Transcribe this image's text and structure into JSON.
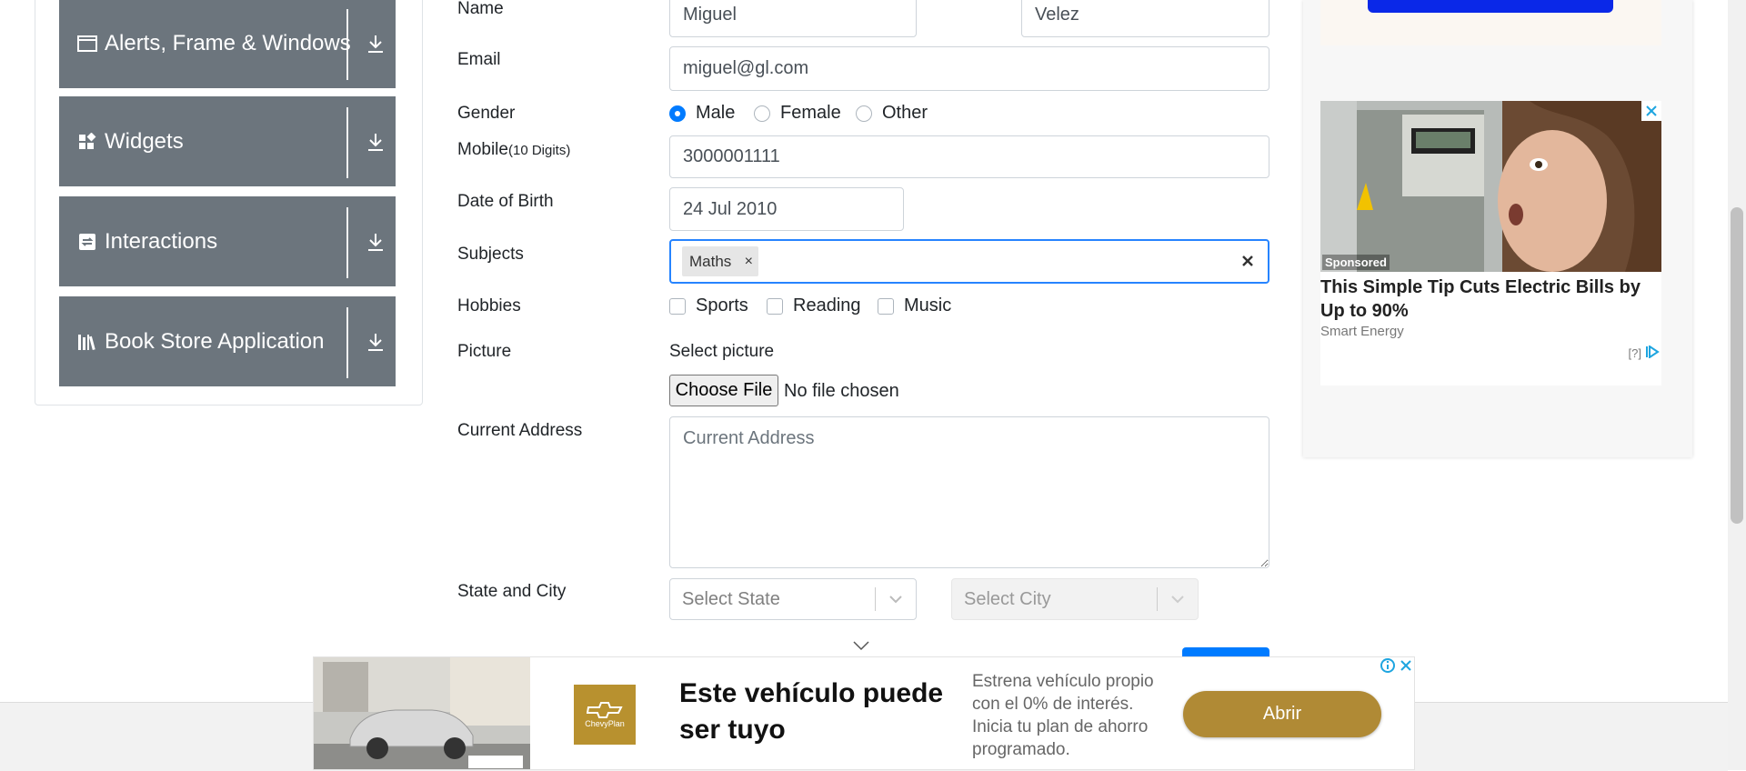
{
  "sidebar": {
    "groups": [
      {
        "label": "Alerts, Frame & Windows",
        "icon": "window-icon"
      },
      {
        "label": "Widgets",
        "icon": "widgets-icon"
      },
      {
        "label": "Interactions",
        "icon": "interactions-icon"
      },
      {
        "label": "Book Store Application",
        "icon": "books-icon"
      }
    ]
  },
  "form": {
    "name_label": "Name",
    "first_name": "Miguel",
    "last_name": "Velez",
    "email_label": "Email",
    "email": "miguel@gl.com",
    "gender_label": "Gender",
    "gender_options": [
      "Male",
      "Female",
      "Other"
    ],
    "gender_selected": "Male",
    "mobile_label": "Mobile",
    "mobile_hint": "(10 Digits)",
    "mobile": "3000001111",
    "dob_label": "Date of Birth",
    "dob": "24 Jul 2010",
    "subjects_label": "Subjects",
    "subjects": [
      "Maths"
    ],
    "hobbies_label": "Hobbies",
    "hobbies": [
      "Sports",
      "Reading",
      "Music"
    ],
    "picture_label": "Picture",
    "select_picture": "Select picture",
    "choose_file": "Choose File",
    "no_file": "No file chosen",
    "address_label": "Current Address",
    "address_placeholder": "Current Address",
    "state_city_label": "State and City",
    "state_placeholder": "Select State",
    "city_placeholder": "Select City"
  },
  "side_ad": {
    "sponsored": "Sponsored",
    "headline": "This Simple Tip Cuts Electric Bills by Up to 90%",
    "source": "Smart Energy",
    "mark": "[?]"
  },
  "bottom_ad": {
    "brand": "ChevyPlan",
    "headline": "Este vehículo puede ser tuyo",
    "description": "Estrena vehículo propio con el 0% de interés. Inicia tu plan de ahorro programado.",
    "cta": "Abrir"
  },
  "colors": {
    "sidebar_group": "#6c757d",
    "accent": "#007bff",
    "focus": "#2684ff",
    "ad_cta": "#b08a35"
  }
}
